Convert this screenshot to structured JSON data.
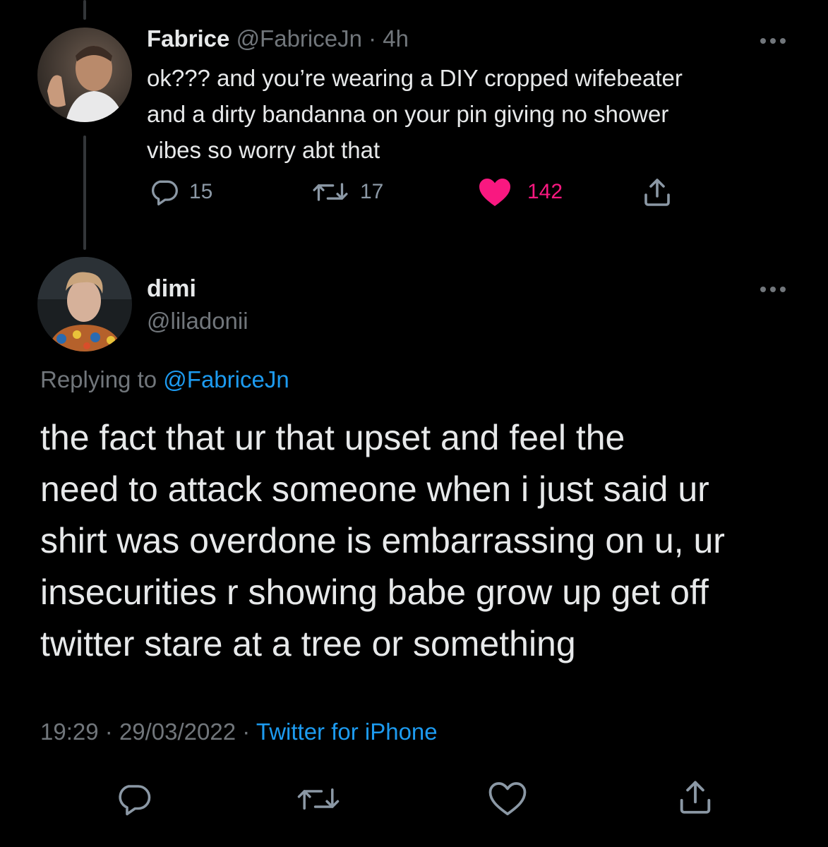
{
  "parent_tweet": {
    "display_name": "Fabrice",
    "handle": "@FabriceJn",
    "time": "· 4h",
    "text": "ok??? and you’re wearing a DIY cropped wifebeater\nand a dirty bandanna on your pin giving no shower\nvibes so worry abt that",
    "actions": {
      "replies": "15",
      "retweets": "17",
      "likes": "142"
    },
    "liked": true
  },
  "main_tweet": {
    "display_name": "dimi",
    "handle": "@liladonii",
    "replying_label": "Replying to",
    "replying_handle": "@FabriceJn",
    "text": "the fact that ur that upset and feel the\nneed to attack someone when i just said ur\nshirt was overdone is embarrassing on u, ur\ninsecurities r showing babe grow up get off\ntwitter stare at a tree or something",
    "time": "19:29",
    "date": "29/03/2022",
    "separator": "·",
    "source": "Twitter for iPhone"
  },
  "icons": {
    "reply": "reply-icon",
    "retweet": "retweet-icon",
    "like": "heart-icon",
    "share": "share-icon",
    "more": "more-icon"
  },
  "colors": {
    "background": "#000000",
    "text": "#e7e9ea",
    "muted": "#71767b",
    "link": "#1d9bf0",
    "like": "#f91880"
  }
}
